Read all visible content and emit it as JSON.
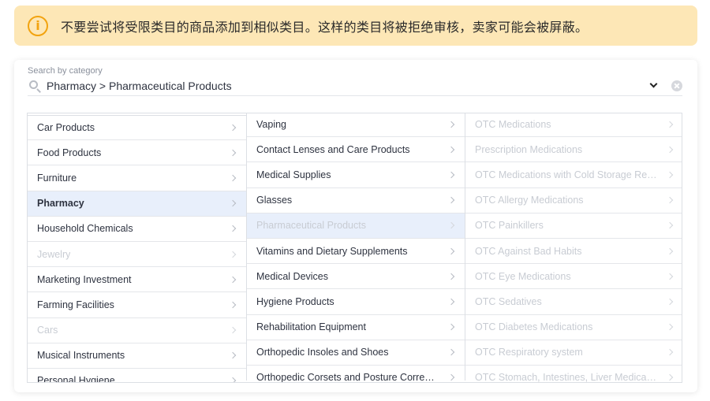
{
  "warning": {
    "icon": "info-icon",
    "text": "不要尝试将受限类目的商品添加到相似类目。这样的类目将被拒绝审核，卖家可能会被屏蔽。",
    "color": "#fde7b6"
  },
  "search": {
    "label": "Search by category",
    "value": "Pharmacy > Pharmaceutical Products",
    "placeholder": ""
  },
  "column1": [
    {
      "label": "Car Products",
      "state": "normal"
    },
    {
      "label": "Food Products",
      "state": "normal"
    },
    {
      "label": "Furniture",
      "state": "normal"
    },
    {
      "label": "Pharmacy",
      "state": "selected"
    },
    {
      "label": "Household Chemicals",
      "state": "normal"
    },
    {
      "label": "Jewelry",
      "state": "disabled"
    },
    {
      "label": "Marketing Investment",
      "state": "normal"
    },
    {
      "label": "Farming Facilities",
      "state": "normal"
    },
    {
      "label": "Cars",
      "state": "disabled"
    },
    {
      "label": "Musical Instruments",
      "state": "normal"
    },
    {
      "label": "Personal Hygiene",
      "state": "normal"
    }
  ],
  "column2": [
    {
      "label": "Vaping",
      "state": "normal"
    },
    {
      "label": "Contact Lenses and Care Products",
      "state": "normal"
    },
    {
      "label": "Medical Supplies",
      "state": "normal"
    },
    {
      "label": "Glasses",
      "state": "normal"
    },
    {
      "label": "Pharmaceutical Products",
      "state": "selected-disabled"
    },
    {
      "label": "Vitamins and Dietary Supplements",
      "state": "normal"
    },
    {
      "label": "Medical Devices",
      "state": "normal"
    },
    {
      "label": "Hygiene Products",
      "state": "normal"
    },
    {
      "label": "Rehabilitation Equipment",
      "state": "normal"
    },
    {
      "label": "Orthopedic Insoles and Shoes",
      "state": "normal"
    },
    {
      "label": "Orthopedic Corsets and Posture Correct...",
      "state": "normal"
    }
  ],
  "column3": [
    {
      "label": "OTC Medications",
      "state": "disabled"
    },
    {
      "label": "Prescription Medications",
      "state": "disabled"
    },
    {
      "label": "OTC Medications with Cold Storage Req...",
      "state": "disabled"
    },
    {
      "label": "OTC Allergy Medications",
      "state": "disabled"
    },
    {
      "label": "OTC Painkillers",
      "state": "disabled"
    },
    {
      "label": "OTC Against Bad Habits",
      "state": "disabled"
    },
    {
      "label": "OTC Eye Medications",
      "state": "disabled"
    },
    {
      "label": "OTC Sedatives",
      "state": "disabled"
    },
    {
      "label": "OTC Diabetes Medications",
      "state": "disabled"
    },
    {
      "label": "OTC Respiratory system",
      "state": "disabled"
    },
    {
      "label": "OTC Stomach, Intestines, Liver Medicati...",
      "state": "disabled"
    }
  ],
  "colors": {
    "selected_bg": "#e8effb",
    "disabled_text": "#c8ccd3",
    "warning_accent": "#f2a30f"
  }
}
